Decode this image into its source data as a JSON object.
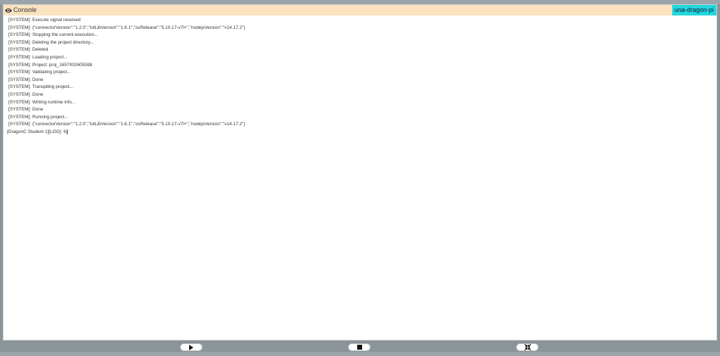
{
  "console": {
    "title": "Console",
    "device": "una-dragon-pi",
    "lines": [
      "[SYSTEM]: Execute signal received",
      "[SYSTEM]: {\"connectorVersion\":\"1.2.0\",\"iotLibVersion\":\"1.6.1\",\"osRelease\":\"5.10.17-v7l+\",\"nodejsVersion\":\"v14.17.2\"}",
      "[SYSTEM]: Stopping the current execution...",
      "[SYSTEM]: Deleting the project directory...",
      "[SYSTEM]: Deleted",
      "[SYSTEM]: Loading project...",
      "[SYSTEM]: Project: proj_1657002605598",
      "[SYSTEM]: Validating project...",
      "[SYSTEM]: Done",
      "[SYSTEM]: Transpiling project...",
      "[SYSTEM]: Done",
      "[SYSTEM]: Writing runtime info...",
      "[SYSTEM]: Done",
      "[SYSTEM]: Running project...",
      "[SYSTEM]: {\"connectorVersion\":\"1.2.0\",\"iotLibVersion\":\"1.6.1\",\"osRelease\":\"5.10.17-v7l+\",\"nodejsVersion\":\"v14.17.2\"}",
      "[DragonC Student 1][LOG]: 6"
    ]
  },
  "icons": {
    "header": "eye-icon",
    "play": "play-icon",
    "stop": "stop-icon",
    "fullscreen": "collapse-icon"
  },
  "colors": {
    "header_bg": "#fbe2bf",
    "badge_bg": "#22d8dc",
    "backdrop": "#8a9499"
  }
}
